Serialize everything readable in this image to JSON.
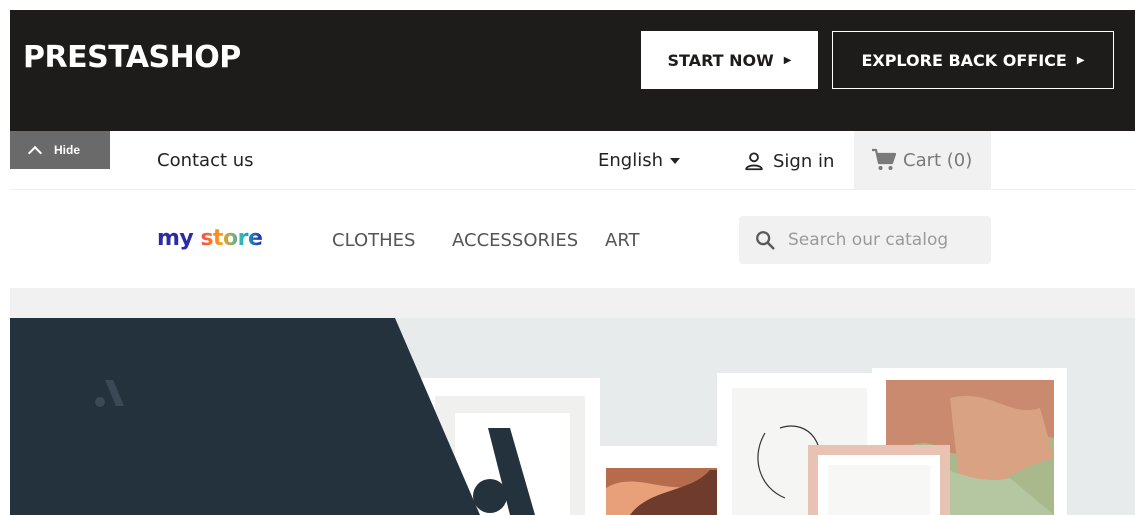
{
  "demo": {
    "brand": "PRESTASHOP",
    "start_now": "START NOW",
    "explore": "EXPLORE BACK OFFICE"
  },
  "toggle": {
    "hide_label": "Hide"
  },
  "nav": {
    "contact": "Contact us",
    "language": "English",
    "sign_in": "Sign in",
    "cart": "Cart (0)"
  },
  "header": {
    "logo_part1": "my",
    "logo_part2": "store",
    "menu": [
      "CLOTHES",
      "ACCESSORIES",
      "ART"
    ],
    "search_placeholder": "Search our catalog"
  },
  "colors": {
    "demo_bar": "#1e1c1b",
    "hero_dark": "#24323e",
    "wall": "#e6eaea"
  },
  "icons": [
    "chevron-up-icon",
    "caret-down-icon",
    "user-icon",
    "cart-icon",
    "search-icon"
  ]
}
